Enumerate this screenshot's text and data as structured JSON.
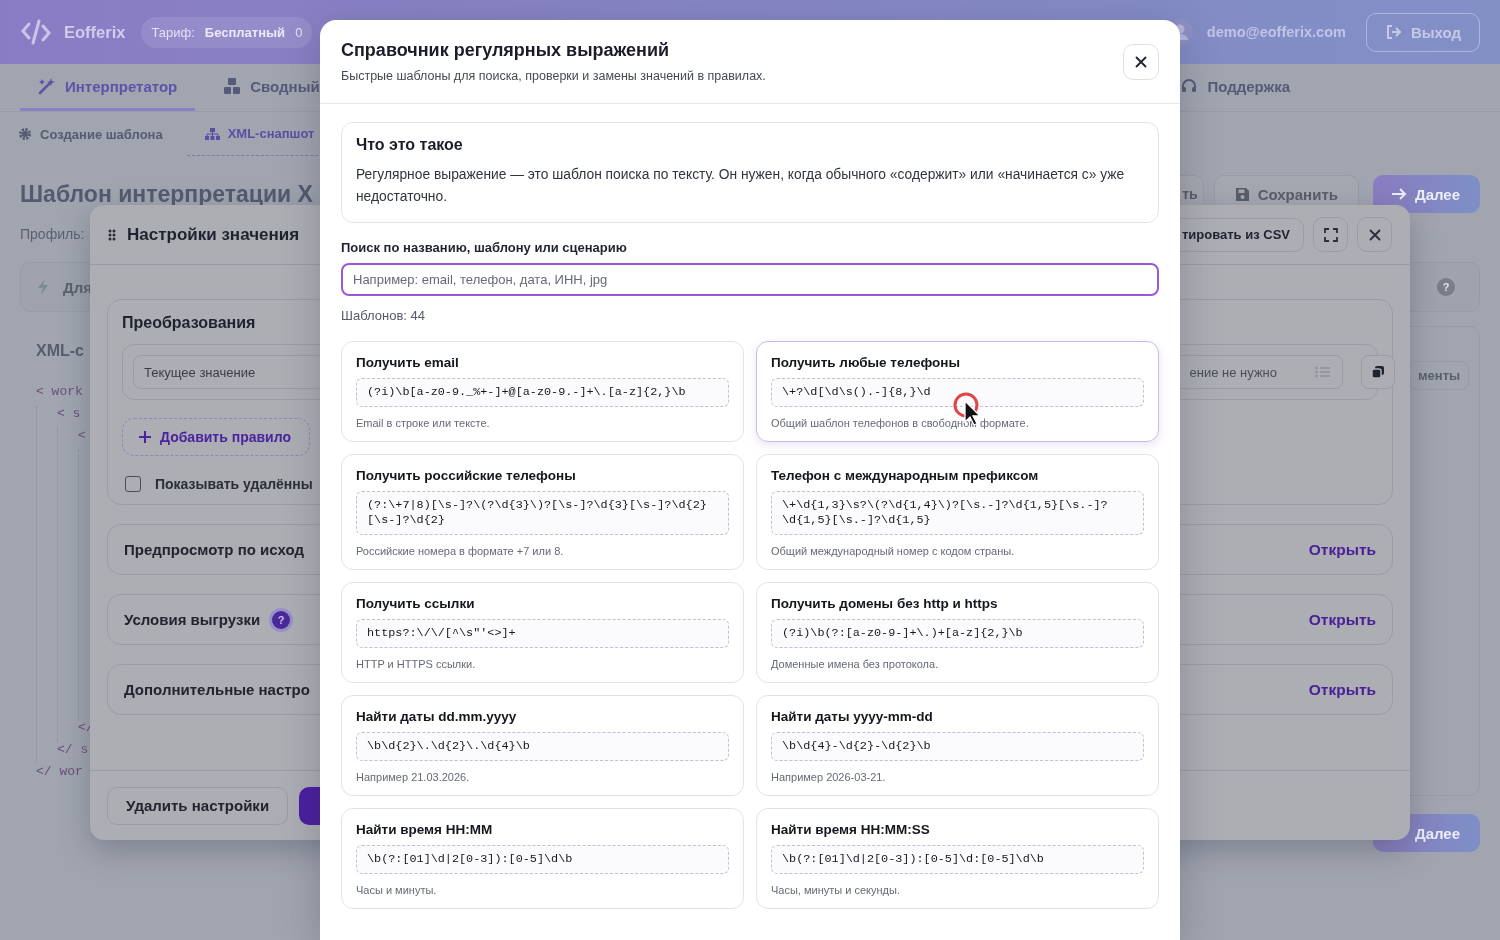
{
  "header": {
    "logo": "Eofferix",
    "plan_label": "Тариф:",
    "plan_value": "Бесплатный",
    "plan_count": "0",
    "user_email": "demo@eofferix.com",
    "logout": "Выход"
  },
  "nav_tabs": [
    {
      "label": "Интерпретатор",
      "selected": true,
      "kind": "wand"
    },
    {
      "label": "Сводный",
      "selected": false,
      "kind": "boxes"
    },
    {
      "label": "Поддержка",
      "selected": false,
      "kind": "support"
    }
  ],
  "sub_tabs": [
    {
      "label": "Создание шаблона",
      "selected": false,
      "kind": "gear"
    },
    {
      "label": "XML-снапшот",
      "selected": true,
      "kind": "tree"
    }
  ],
  "page": {
    "title": "Шаблон интерпретации X",
    "actions": [
      {
        "label": "ть",
        "kind": "plain"
      },
      {
        "label": "Сохранить",
        "kind": "save"
      },
      {
        "label": "Далее",
        "kind": "next"
      }
    ],
    "profile_label": "Профиль:",
    "hint": "Для",
    "help": "?",
    "xml_heading": "XML-с",
    "xml_tree": [
      {
        "open": "< work",
        "close": "</ wor",
        "children": [
          {
            "open": "< s",
            "close": "</ s",
            "children": [
              {
                "open": "<",
                "close": "</"
              }
            ]
          }
        ]
      }
    ],
    "side_button": "менты",
    "bottom_action": "Далее"
  },
  "value_dialog": {
    "title": "Настройки значения",
    "import_button": "тировать из CSV",
    "transform_title": "Преобразования",
    "source_field": "Текущее значение",
    "target_field": "ение не нужно",
    "add_rule": "Добавить правило",
    "show_deleted": {
      "label": "Показывать удалённы",
      "checked": false
    },
    "sections": [
      {
        "title": "Предпросмотр по исход",
        "action": "Открыть"
      },
      {
        "title": "Условия выгрузки",
        "help": "?",
        "action": "Открыть"
      },
      {
        "title": "Дополнительные настро",
        "action": "Открыть"
      }
    ],
    "delete_button": "Удалить настройки"
  },
  "regex_modal": {
    "title": "Справочник регулярных выражений",
    "subtitle": "Быстрые шаблоны для поиска, проверки и замены значений в правилах.",
    "info": {
      "title": "Что это такое",
      "text": "Регулярное выражение — это шаблон поиска по тексту. Он нужен, когда обычного «содержит» или «начинается с» уже недостаточно."
    },
    "search": {
      "label": "Поиск по названию, шаблону или сценарию",
      "placeholder": "Например: email, телефон, дата, ИНН, jpg",
      "focused": true
    },
    "count": "Шаблонов: 44",
    "templates": [
      {
        "title": "Получить email",
        "pattern": "(?i)\\b[a-z0-9._%+-]+@[a-z0-9.-]+\\.[a-z]{2,}\\b",
        "description": "Email в строке или тексте.",
        "hovered": false
      },
      {
        "title": "Получить любые телефоны",
        "pattern": "\\+?\\d[\\d\\s().-]{8,}\\d",
        "description": "Общий шаблон телефонов в свободном формате.",
        "hovered": true
      },
      {
        "title": "Получить российские телефоны",
        "pattern": "(?:\\+7|8)[\\s-]?\\(?\\d{3}\\)?[\\s-]?\\d{3}[\\s-]?\\d{2}[\\s-]?\\d{2}",
        "description": "Российские номера в формате +7 или 8.",
        "hovered": false
      },
      {
        "title": "Телефон с международным префиксом",
        "pattern": "\\+\\d{1,3}\\s?\\(?\\d{1,4}\\)?[\\s.-]?\\d{1,5}[\\s.-]?\\d{1,5}[\\s.-]?\\d{1,5}",
        "description": "Общий международный номер с кодом страны.",
        "hovered": false
      },
      {
        "title": "Получить ссылки",
        "pattern": "https?:\\/\\/[^\\s\"'<>]+",
        "description": "HTTP и HTTPS ссылки.",
        "hovered": false
      },
      {
        "title": "Получить домены без http и https",
        "pattern": "(?i)\\b(?:[a-z0-9-]+\\.)+[a-z]{2,}\\b",
        "description": "Доменные имена без протокола.",
        "hovered": false
      },
      {
        "title": "Найти даты dd.mm.yyyy",
        "pattern": "\\b\\d{2}\\.\\d{2}\\.\\d{4}\\b",
        "description": "Например 21.03.2026.",
        "hovered": false
      },
      {
        "title": "Найти даты yyyy-mm-dd",
        "pattern": "\\b\\d{4}-\\d{2}-\\d{2}\\b",
        "description": "Например 2026-03-21.",
        "hovered": false
      },
      {
        "title": "Найти время HH:MM",
        "pattern": "\\b(?:[01]\\d|2[0-3]):[0-5]\\d\\b",
        "description": "Часы и минуты.",
        "hovered": false
      },
      {
        "title": "Найти время HH:MM:SS",
        "pattern": "\\b(?:[01]\\d|2[0-3]):[0-5]\\d:[0-5]\\d\\b",
        "description": "Часы, минуты и секунды.",
        "hovered": false
      }
    ]
  }
}
